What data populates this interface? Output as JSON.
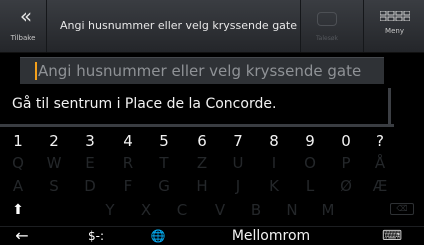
{
  "topbar": {
    "back_glyph": "«",
    "back_label": "Tilbake",
    "title": "Angi husnummer eller velg kryssende gate",
    "secondary_icon": "speech-bubble-icon",
    "secondary_label": "Talesøk",
    "menu_icon": "grid-icon",
    "menu_label": "Meny"
  },
  "input": {
    "placeholder": "Angi husnummer eller velg kryssende gate",
    "cursor_color": "#f4a01b"
  },
  "suggestion": {
    "text": "Gå til sentrum i Place de la Concorde."
  },
  "keyboard": {
    "numbers": [
      "1",
      "2",
      "3",
      "4",
      "5",
      "6",
      "7",
      "8",
      "9",
      "0",
      "?"
    ],
    "row1": [
      "Q",
      "W",
      "E",
      "R",
      "T",
      "Z",
      "U",
      "I",
      "O",
      "P",
      "Å"
    ],
    "row2": [
      "A",
      "S",
      "D",
      "F",
      "G",
      "H",
      "J",
      "K",
      "L",
      "Ø",
      "Æ"
    ],
    "row3": [
      "Y",
      "X",
      "C",
      "V",
      "B",
      "N",
      "M"
    ],
    "shift_glyph": "⬆",
    "backspace_glyph": "⌫",
    "left_arrow": "←",
    "symbols_label": "$-:",
    "globe_glyph": "🌐",
    "space_label": "Mellomrom",
    "kbd_glyph": "⌨"
  }
}
